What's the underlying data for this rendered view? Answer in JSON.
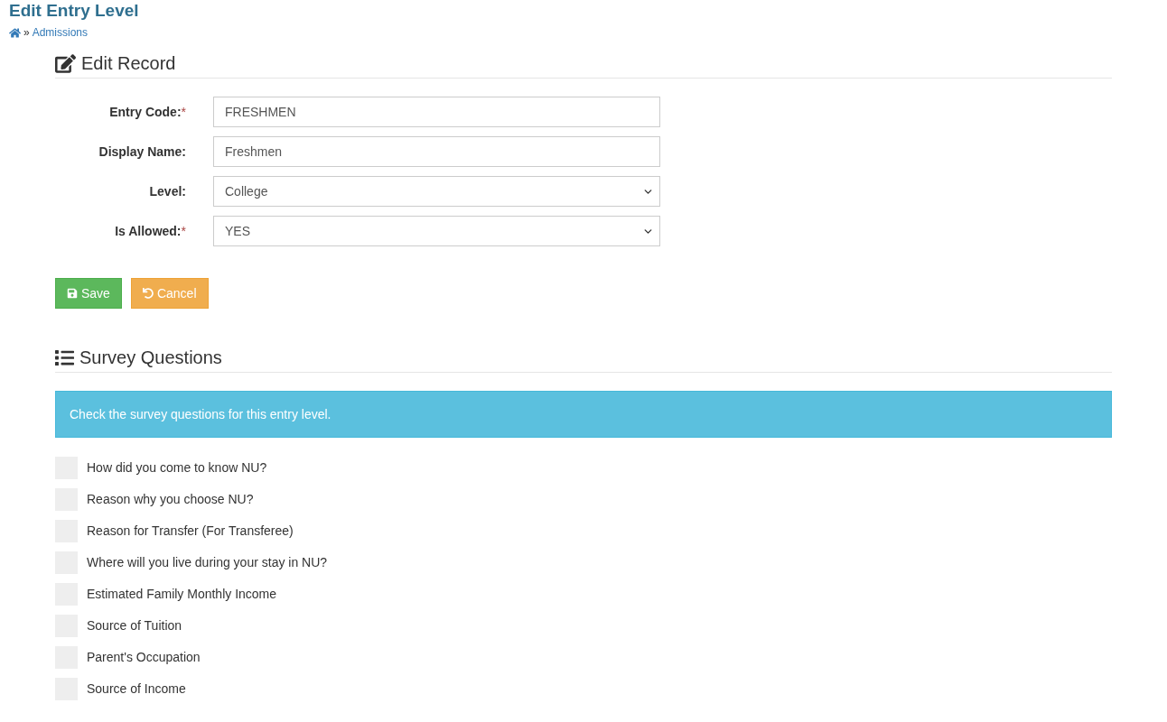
{
  "page": {
    "title": "Edit Entry Level"
  },
  "breadcrumb": {
    "separator": "»",
    "items": [
      {
        "label": "Admissions"
      }
    ]
  },
  "edit_record": {
    "heading": "Edit Record",
    "fields": [
      {
        "kind": "text",
        "label": "Entry Code:",
        "required_mark": "*",
        "value": "FRESHMEN"
      },
      {
        "kind": "text",
        "label": "Display Name:",
        "value": "Freshmen"
      },
      {
        "kind": "select",
        "label": "Level:",
        "value": "College"
      },
      {
        "kind": "select",
        "label": "Is Allowed:",
        "required_mark": "*",
        "value": "YES"
      }
    ],
    "buttons": [
      {
        "kind": "save",
        "label": "Save"
      },
      {
        "kind": "cancel",
        "label": "Cancel"
      }
    ]
  },
  "survey_questions": {
    "heading": "Survey Questions",
    "alert": "Check the survey questions for this entry level.",
    "questions": [
      {
        "label": "How did you come to know NU?",
        "checked": false
      },
      {
        "label": "Reason why you choose NU?",
        "checked": false
      },
      {
        "label": "Reason for Transfer (For Transferee)",
        "checked": false
      },
      {
        "label": "Where will you live during your stay in NU?",
        "checked": false
      },
      {
        "label": "Estimated Family Monthly Income",
        "checked": false
      },
      {
        "label": "Source of Tuition",
        "checked": false
      },
      {
        "label": "Parent's Occupation",
        "checked": false
      },
      {
        "label": "Source of Income",
        "checked": false
      }
    ]
  }
}
